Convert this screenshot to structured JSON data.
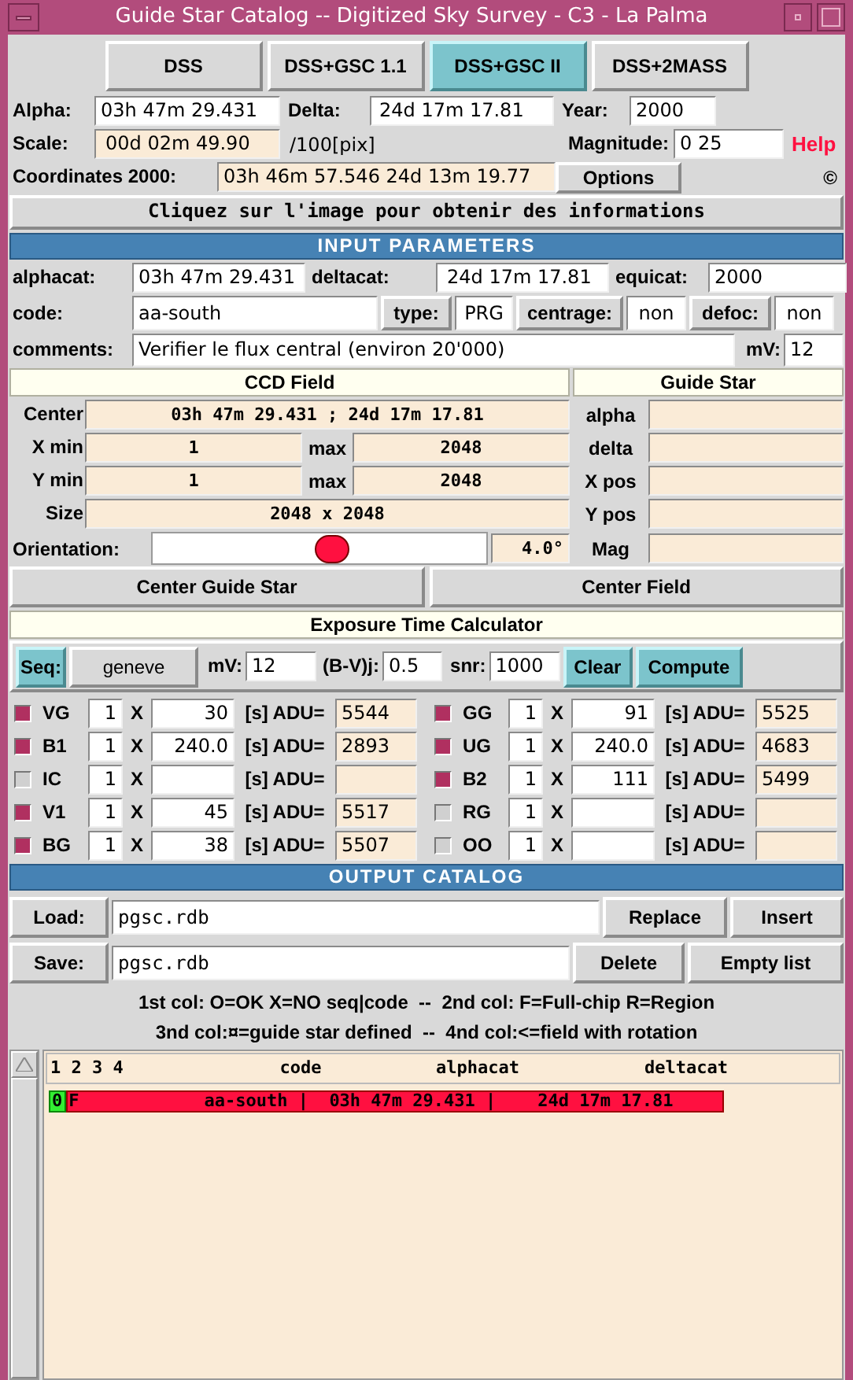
{
  "window": {
    "title": "Guide Star Catalog -- Digitized Sky Survey - C3 - La Palma"
  },
  "survey_buttons": [
    {
      "label": "DSS",
      "selected": false
    },
    {
      "label": "DSS+GSC 1.1",
      "selected": false
    },
    {
      "label": "DSS+GSC II",
      "selected": true
    },
    {
      "label": "DSS+2MASS",
      "selected": false
    }
  ],
  "alpha": {
    "label": "Alpha:",
    "value": "03h 47m 29.431"
  },
  "delta": {
    "label": "Delta:",
    "value": "24d 17m 17.81"
  },
  "year": {
    "label": "Year:",
    "value": "2000"
  },
  "scale": {
    "label": "Scale:",
    "value": "00d 02m 49.90",
    "unit": "/100[pix]"
  },
  "magnitude": {
    "label": "Magnitude:",
    "value": "0 25"
  },
  "help": "Help",
  "coordinates": {
    "label": "Coordinates 2000:",
    "value": "03h 46m 57.546  24d 13m 19.77"
  },
  "options_button": "Options",
  "copyright": "©",
  "info_banner": "Cliquez sur l'image pour obtenir des informations",
  "input_parameters": {
    "title": "INPUT PARAMETERS",
    "alphacat": {
      "label": "alphacat:",
      "value": "03h 47m 29.431"
    },
    "deltacat": {
      "label": "deltacat:",
      "value": "24d 17m 17.81"
    },
    "equicat": {
      "label": "equicat:",
      "value": "2000"
    },
    "code": {
      "label": "code:",
      "value": "aa-south"
    },
    "type": {
      "label": "type:",
      "value": "PRG"
    },
    "centrage": {
      "label": "centrage:",
      "value": "non"
    },
    "defoc": {
      "label": "defoc:",
      "value": "non"
    },
    "comments": {
      "label": "comments:",
      "value": "Verifier le flux central (environ 20'000)"
    },
    "mv": {
      "label": "mV:",
      "value": "12"
    }
  },
  "ccd_field": {
    "title": "CCD Field",
    "center": {
      "label": "Center",
      "value": "03h 47m 29.431 ;  24d 17m 17.81"
    },
    "x": {
      "label": "X min",
      "value": "1",
      "max_label": "max",
      "max_value": "2048"
    },
    "y": {
      "label": "Y min",
      "value": "1",
      "max_label": "max",
      "max_value": "2048"
    },
    "size": {
      "label": "Size",
      "value": "2048 x 2048"
    },
    "orientation": {
      "label": "Orientation:",
      "level": 0.54,
      "value": "4.0°"
    }
  },
  "guide_star": {
    "title": "Guide Star",
    "fields": [
      "alpha",
      "delta",
      "X pos",
      "Y pos",
      "Mag"
    ]
  },
  "center_buttons": [
    "Center Guide Star",
    "Center Field"
  ],
  "exposure": {
    "title": "Exposure Time Calculator",
    "seq_button": "Seq:",
    "sequence": "geneve",
    "mv": {
      "label": "mV:",
      "value": "12"
    },
    "bv": {
      "label": "(B-V)j:",
      "value": "0.5"
    },
    "snr": {
      "label": "snr:",
      "value": "1000"
    },
    "clear": "Clear",
    "compute": "Compute",
    "filters": [
      {
        "name": "VG",
        "checked": true,
        "count": "1",
        "x": "X",
        "exposure": "30",
        "unit": "[s] ADU=",
        "adu": "5544"
      },
      {
        "name": "GG",
        "checked": true,
        "count": "1",
        "x": "X",
        "exposure": "91",
        "unit": "[s] ADU=",
        "adu": "5525"
      },
      {
        "name": "B1",
        "checked": true,
        "count": "1",
        "x": "X",
        "exposure": "240.0",
        "unit": "[s] ADU=",
        "adu": "2893"
      },
      {
        "name": "UG",
        "checked": true,
        "count": "1",
        "x": "X",
        "exposure": "240.0",
        "unit": "[s] ADU=",
        "adu": "4683"
      },
      {
        "name": "IC",
        "checked": false,
        "count": "1",
        "x": "X",
        "unit": "[s] ADU="
      },
      {
        "name": "B2",
        "checked": true,
        "count": "1",
        "x": "X",
        "exposure": "111",
        "unit": "[s] ADU=",
        "adu": "5499"
      },
      {
        "name": "V1",
        "checked": true,
        "count": "1",
        "x": "X",
        "exposure": "45",
        "unit": "[s] ADU=",
        "adu": "5517"
      },
      {
        "name": "RG",
        "checked": false,
        "count": "1",
        "x": "X",
        "unit": "[s] ADU="
      },
      {
        "name": "BG",
        "checked": true,
        "count": "1",
        "x": "X",
        "exposure": "38",
        "unit": "[s] ADU=",
        "adu": "5507"
      },
      {
        "name": "OO",
        "checked": false,
        "count": "1",
        "x": "X",
        "unit": "[s] ADU="
      }
    ]
  },
  "output_catalog": {
    "title": "OUTPUT CATALOG",
    "load": {
      "button": "Load:",
      "value": "pgsc.rdb"
    },
    "replace": "Replace",
    "insert": "Insert",
    "save": {
      "button": "Save:",
      "value": "pgsc.rdb"
    },
    "delete": "Delete",
    "empty_list": "Empty list",
    "legend": [
      "1st col: O=OK X=NO seq|code  --  2nd col: F=Full-chip R=Region",
      "3nd col:¤=guide star defined  --  4nd col:<=field with rotation"
    ],
    "header": "1 2 3 4               code           alphacat            deltacat",
    "rows": [
      {
        "flag": "0",
        "line": "F            aa-south |  03h 47m 29.431 |    24d 17m 17.81",
        "selected": true
      }
    ]
  }
}
